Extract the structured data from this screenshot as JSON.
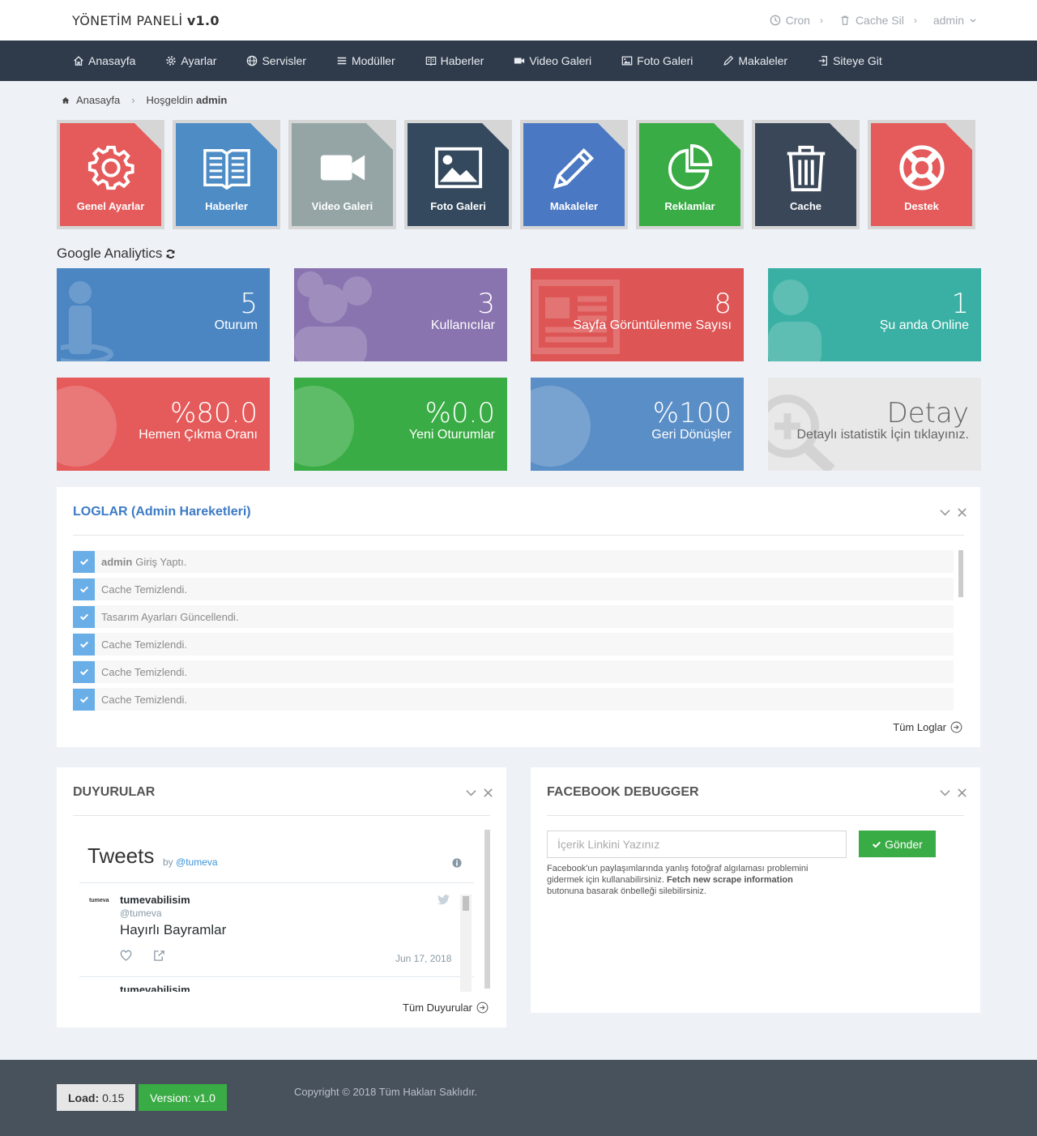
{
  "header": {
    "brand": "YÖNETİM PANELİ",
    "version": "v1.0",
    "cron": "Cron",
    "cache_clear": "Cache Sil",
    "user": "admin"
  },
  "nav": {
    "items": [
      {
        "label": "Anasayfa",
        "icon": "home-icon"
      },
      {
        "label": "Ayarlar",
        "icon": "gear-icon"
      },
      {
        "label": "Servisler",
        "icon": "globe-icon"
      },
      {
        "label": "Modüller",
        "icon": "list-icon"
      },
      {
        "label": "Haberler",
        "icon": "book-icon"
      },
      {
        "label": "Video Galeri",
        "icon": "video-icon"
      },
      {
        "label": "Foto Galeri",
        "icon": "image-icon"
      },
      {
        "label": "Makaleler",
        "icon": "pencil-icon"
      },
      {
        "label": "Siteye Git",
        "icon": "sign-in-icon"
      }
    ]
  },
  "breadcrumb": {
    "home": "Anasayfa",
    "welcome": "Hoşgeldin",
    "user": "admin"
  },
  "tiles": [
    {
      "label": "Genel Ayarlar",
      "color": "#e55a5a",
      "icon": "gear-icon"
    },
    {
      "label": "Haberler",
      "color": "#4e8cc6",
      "icon": "book-icon"
    },
    {
      "label": "Video Galeri",
      "color": "#95a5a6",
      "icon": "video-icon"
    },
    {
      "label": "Foto Galeri",
      "color": "#34495e",
      "icon": "image-icon"
    },
    {
      "label": "Makaleler",
      "color": "#4a78c2",
      "icon": "pencil-icon"
    },
    {
      "label": "Reklamlar",
      "color": "#3aac45",
      "icon": "pie-chart-icon"
    },
    {
      "label": "Cache",
      "color": "#3a4758",
      "icon": "trash-icon"
    },
    {
      "label": "Destek",
      "color": "#e55a5a",
      "icon": "life-ring-icon"
    }
  ],
  "analytics": {
    "title": "Google Analiytics",
    "stats": [
      {
        "value": "5",
        "label": "Oturum",
        "color": "#4b86c2"
      },
      {
        "value": "3",
        "label": "Kullanıcılar",
        "color": "#8a74b0"
      },
      {
        "value": "8",
        "label": "Sayfa Görüntülenme Sayısı",
        "color": "#dd5555"
      },
      {
        "value": "1",
        "label": "Şu anda Online",
        "color": "#3ab0a4"
      },
      {
        "value": "%80.0",
        "label": "Hemen Çıkma Oranı",
        "color": "#e55a5a"
      },
      {
        "value": "%0.0",
        "label": "Yeni Oturumlar",
        "color": "#3aac45"
      },
      {
        "value": "%100",
        "label": "Geri Dönüşler",
        "color": "#5a8ec6"
      },
      {
        "value": "Detay",
        "label": "Detaylı istatistik İçin tıklayınız.",
        "color": "#e8e8e8"
      }
    ]
  },
  "logs": {
    "title": "LOGLAR (Admin Hareketleri)",
    "items": [
      {
        "user": "admin",
        "text": "Giriş Yaptı."
      },
      {
        "user": "",
        "text": "Cache Temizlendi."
      },
      {
        "user": "",
        "text": "Tasarım Ayarları Güncellendi."
      },
      {
        "user": "",
        "text": "Cache Temizlendi."
      },
      {
        "user": "",
        "text": "Cache Temizlendi."
      },
      {
        "user": "",
        "text": "Cache Temizlendi."
      }
    ],
    "all_link": "Tüm Loglar"
  },
  "announcements": {
    "title": "DUYURULAR",
    "tweets_title": "Tweets",
    "by": "by",
    "handle": "@tumeva",
    "tweet": {
      "avatar_text": "tumeva",
      "name": "tumevabilisim",
      "handle": "@tumeva",
      "text": "Hayırlı Bayramlar",
      "date": "Jun 17, 2018"
    },
    "all_link": "Tüm Duyurular"
  },
  "facebook": {
    "title": "FACEBOOK DEBUGGER",
    "placeholder": "İçerik Linkini Yazınız",
    "button": "Gönder",
    "help_1": "Facebook'un paylaşımlarında yanlış fotoğraf algılaması problemini gidermek için kullanabilirsiniz.",
    "help_bold": "Fetch new scrape information",
    "help_2": "butonuna basarak önbelleği silebilirsiniz."
  },
  "footer": {
    "load_label": "Load:",
    "load_value": "0.15",
    "version": "Version: v1.0",
    "copyright": "Copyright © 2018 Tüm Hakları Saklıdır."
  }
}
